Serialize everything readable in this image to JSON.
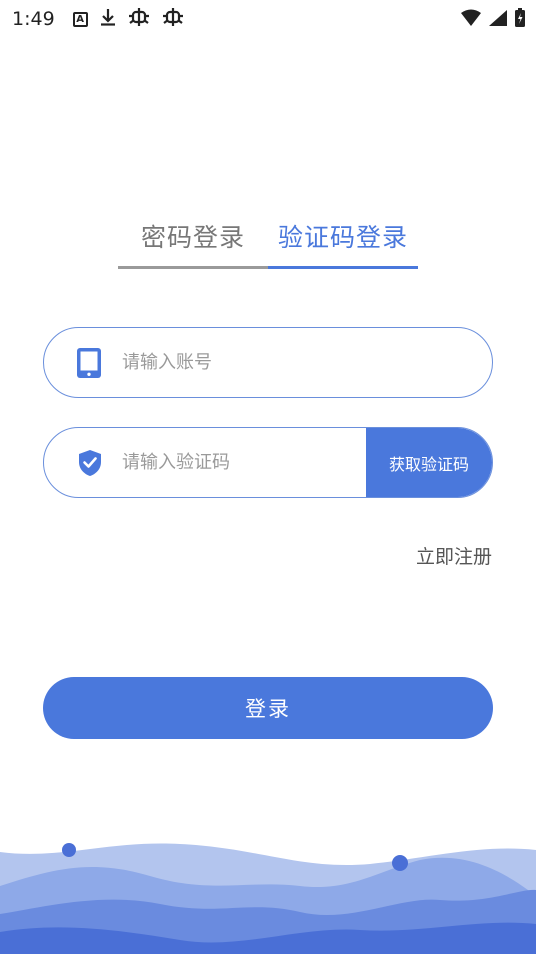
{
  "status_bar": {
    "time": "1:49",
    "icons": [
      "a-badge-icon",
      "download-icon",
      "bug-icon",
      "bug-icon"
    ],
    "right_icons": [
      "wifi-icon",
      "signal-icon",
      "battery-charging-icon"
    ]
  },
  "tabs": [
    {
      "label": "密码登录",
      "active": false
    },
    {
      "label": "验证码登录",
      "active": true
    }
  ],
  "account": {
    "placeholder": "请输入账号",
    "value": "",
    "icon": "tablet-icon"
  },
  "code": {
    "placeholder": "请输入验证码",
    "value": "",
    "icon": "shield-check-icon",
    "button_label": "获取验证码"
  },
  "register_label": "立即注册",
  "login_label": "登录",
  "colors": {
    "accent": "#4a78dc",
    "wave_light": "#b3c5ee",
    "wave_mid": "#7f9ce6",
    "wave_dark": "#4a6fd6"
  }
}
